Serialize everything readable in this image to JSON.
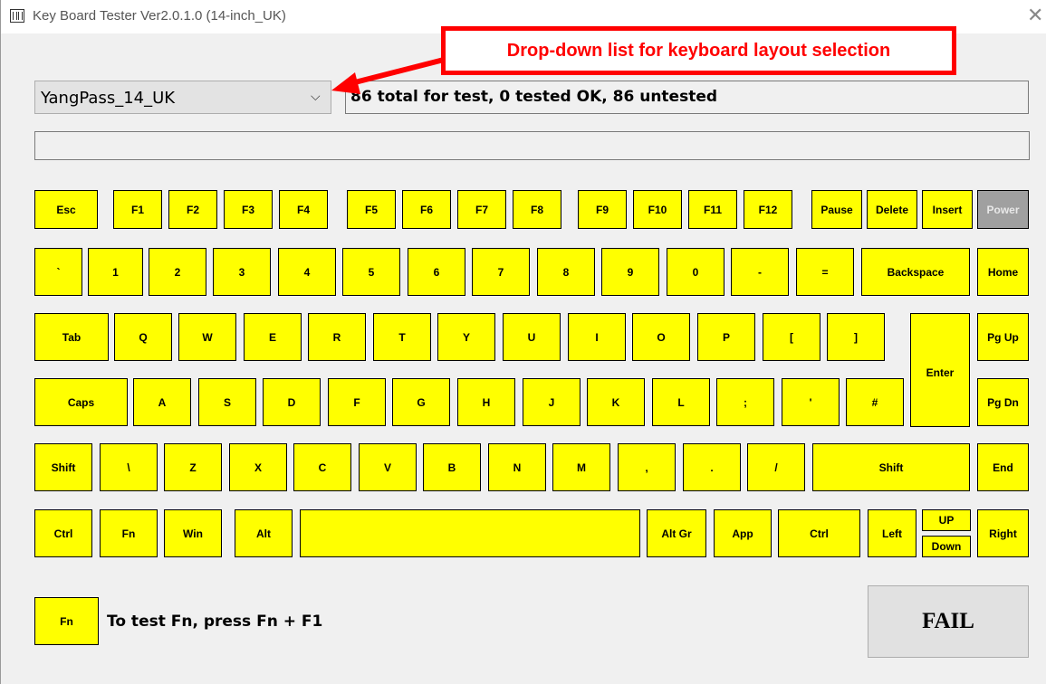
{
  "window": {
    "title": "Key Board Tester Ver2.0.1.0 (14-inch_UK)",
    "close_glyph": "✕"
  },
  "controls": {
    "layout_selected": "YangPass_14_UK",
    "chevron_glyph": "⌵",
    "status": "86 total for test, 0 tested OK, 86 untested",
    "input_value": ""
  },
  "annotation": {
    "callout": "Drop-down list for keyboard layout selection",
    "color": "#ff0000"
  },
  "colors": {
    "untested_key": "#ffff00",
    "disabled_key": "#a0a0a0"
  },
  "keyboard": {
    "row1": [
      "Esc",
      "F1",
      "F2",
      "F3",
      "F4",
      "F5",
      "F6",
      "F7",
      "F8",
      "F9",
      "F10",
      "F11",
      "F12",
      "Pause",
      "Delete",
      "Insert",
      "Power"
    ],
    "row2": [
      "`",
      "1",
      "2",
      "3",
      "4",
      "5",
      "6",
      "7",
      "8",
      "9",
      "0",
      "-",
      "=",
      "Backspace",
      "Home"
    ],
    "row3": [
      "Tab",
      "Q",
      "W",
      "E",
      "R",
      "T",
      "Y",
      "U",
      "I",
      "O",
      "P",
      "[",
      "]",
      "Enter",
      "Pg Up"
    ],
    "row4": [
      "Caps",
      "A",
      "S",
      "D",
      "F",
      "G",
      "H",
      "J",
      "K",
      "L",
      ";",
      "'",
      "#",
      "Pg Dn"
    ],
    "row5": [
      "Shift",
      "\\",
      "Z",
      "X",
      "C",
      "V",
      "B",
      "N",
      "M",
      ",",
      ".",
      "/",
      "Shift",
      "End"
    ],
    "row6": [
      "Ctrl",
      "Fn",
      "Win",
      "Alt",
      "",
      "Alt Gr",
      "App",
      "Ctrl",
      "Left",
      "UP",
      "Down",
      "Right"
    ]
  },
  "footer": {
    "fn_key": "Fn",
    "fn_hint": "To test Fn, press Fn + F1",
    "result": "FAIL"
  }
}
